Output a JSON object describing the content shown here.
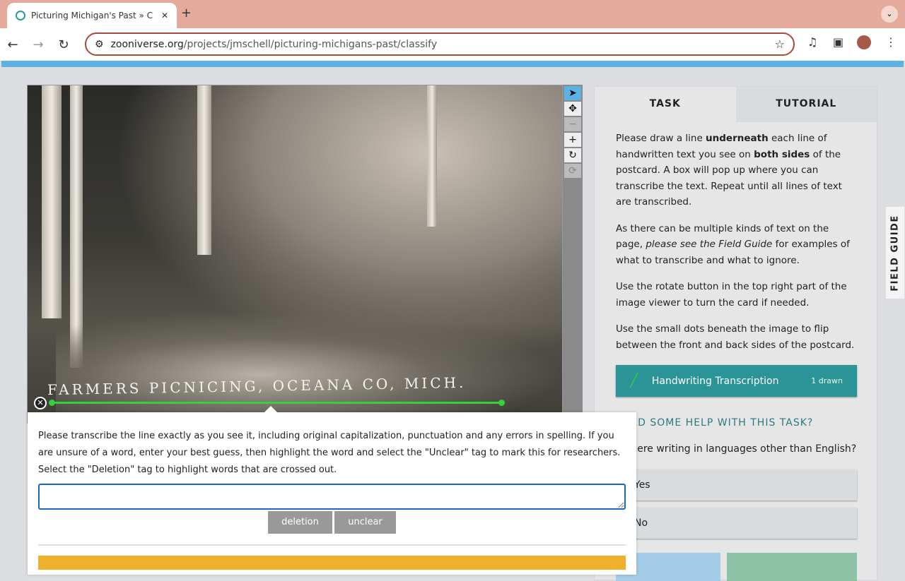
{
  "browser": {
    "tab_title": "Picturing Michigan's Past » C",
    "url_host": "zooniverse.org",
    "url_path": "/projects/jmschell/picturing-michigans-past/classify"
  },
  "viewer": {
    "caption": "FARMERS PICNICING, OCEANA CO, MICH.",
    "tools": [
      "pointer-icon",
      "move-icon",
      "zoom-out-icon",
      "zoom-in-icon",
      "rotate-icon",
      "reset-icon"
    ]
  },
  "panel": {
    "tabs": [
      "TASK",
      "TUTORIAL"
    ],
    "instructions": {
      "p1a": "Please draw a line ",
      "p1b": "underneath",
      "p1c": " each line of handwritten text you see on ",
      "p1d": "both sides",
      "p1e": " of the postcard. A box will pop up where you can transcribe the text. Repeat until all lines of text are transcribed.",
      "p2a": "As there can be multiple kinds of text on the page, ",
      "p2b": "please see the Field Guide",
      "p2c": " for examples of what to transcribe and what to ignore.",
      "p3": "Use the rotate button in the top right part of the image viewer to turn the card if needed.",
      "p4": "Use the small dots beneath the image to flip between the front and back sides of the postcard."
    },
    "tool_button": {
      "label": "Handwriting Transcription",
      "count": "1 drawn"
    },
    "help": "NEED SOME HELP WITH THIS TASK?",
    "question": "Is there writing in languages other than English?",
    "answers": [
      "Yes",
      "No"
    ]
  },
  "field_guide": "FIELD GUIDE",
  "popup": {
    "instructions": "Please transcribe the line exactly as you see it, including original capitalization, punctuation and any errors in spelling. If you are unsure of a word, enter your best guess, then highlight the word and select the \"Unclear\" tag to mark this for researchers. Select the \"Deletion\" tag to highlight words that are crossed out.",
    "value": "",
    "tags": [
      "deletion",
      "unclear"
    ]
  }
}
